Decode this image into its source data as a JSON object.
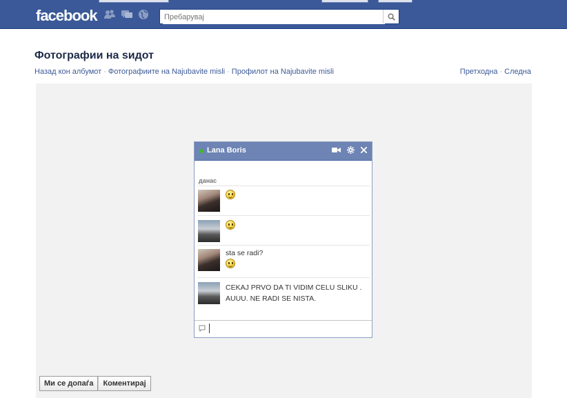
{
  "topbar": {
    "logo": "facebook",
    "search": {
      "placeholder": "Пребарувај",
      "value": ""
    },
    "jewels": [
      "friend-requests-icon",
      "messages-icon",
      "notifications-icon"
    ]
  },
  "page": {
    "title": "Фотографии на ѕидот",
    "breadcrumb": {
      "back": "Назад кон албумот",
      "photos_of": "Фотографиите на Najubavite misli",
      "profile_of": "Профилот на Najubavite misli"
    },
    "pager": {
      "prev": "Претходна",
      "next": "Следна"
    }
  },
  "photo": {
    "chat": {
      "contact_name": "Lana Boris",
      "day_label": "данас",
      "messages": [
        {
          "avatar": "girl",
          "text": "",
          "emoticon": true
        },
        {
          "avatar": "scene",
          "text": "",
          "emoticon": true
        },
        {
          "avatar": "girl",
          "text": "sta se radi?",
          "emoticon": true
        },
        {
          "avatar": "scene",
          "line1": "CEKAJ PRVO DA TI VIDIM CELU SLIKU .",
          "line2": "AUUU. NE RADI SE NISTA."
        }
      ]
    }
  },
  "actions": {
    "like": "Ми се допаѓа",
    "comment": "Коментирај"
  },
  "colors": {
    "brand": "#3b5998",
    "chat_header": "#6d84b4",
    "online": "#42b72a"
  }
}
